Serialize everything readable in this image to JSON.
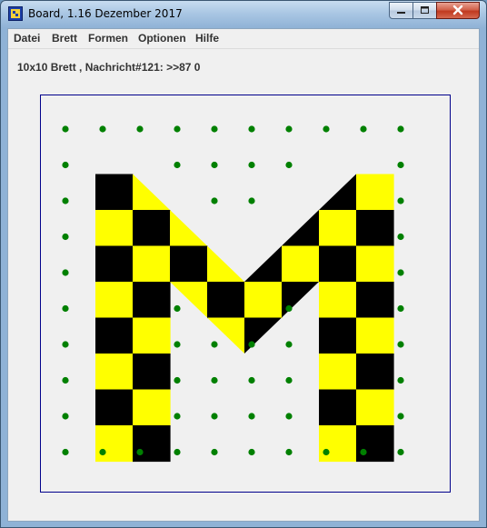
{
  "window": {
    "title": "Board, 1.16 Dezember 2017",
    "icon": "board-app-icon",
    "controls": [
      "minimize-icon",
      "maximize-icon",
      "close-icon"
    ]
  },
  "menu": {
    "items": [
      "Datei",
      "Brett",
      "Formen",
      "Optionen",
      "Hilfe"
    ]
  },
  "status": {
    "text": "10x10 Brett , Nachricht#121: >>87 0"
  },
  "board": {
    "rows": 10,
    "cols": 10,
    "colors": {
      "black": "#000000",
      "yellow": "#ffff00",
      "dot": "#008000",
      "frame": "#00008b",
      "background": "#f0f0f0"
    },
    "cells": [
      {
        "c": 1,
        "r": 1,
        "fill": "black"
      },
      {
        "c": 1,
        "r": 2,
        "fill": "yellow"
      },
      {
        "c": 1,
        "r": 3,
        "fill": "black"
      },
      {
        "c": 1,
        "r": 4,
        "fill": "yellow"
      },
      {
        "c": 1,
        "r": 5,
        "fill": "black"
      },
      {
        "c": 1,
        "r": 6,
        "fill": "yellow"
      },
      {
        "c": 1,
        "r": 7,
        "fill": "black"
      },
      {
        "c": 1,
        "r": 8,
        "fill": "yellow"
      },
      {
        "c": 2,
        "r": 2,
        "fill": "black"
      },
      {
        "c": 2,
        "r": 3,
        "fill": "yellow"
      },
      {
        "c": 2,
        "r": 4,
        "fill": "black"
      },
      {
        "c": 2,
        "r": 5,
        "fill": "yellow"
      },
      {
        "c": 2,
        "r": 6,
        "fill": "black"
      },
      {
        "c": 2,
        "r": 7,
        "fill": "yellow"
      },
      {
        "c": 2,
        "r": 8,
        "fill": "black"
      },
      {
        "c": 3,
        "r": 3,
        "fill": "black"
      },
      {
        "c": 4,
        "r": 4,
        "fill": "black"
      },
      {
        "c": 5,
        "r": 4,
        "fill": "yellow"
      },
      {
        "c": 6,
        "r": 3,
        "fill": "yellow"
      },
      {
        "c": 7,
        "r": 2,
        "fill": "yellow"
      },
      {
        "c": 7,
        "r": 3,
        "fill": "black"
      },
      {
        "c": 7,
        "r": 4,
        "fill": "yellow"
      },
      {
        "c": 7,
        "r": 5,
        "fill": "black"
      },
      {
        "c": 7,
        "r": 6,
        "fill": "yellow"
      },
      {
        "c": 7,
        "r": 7,
        "fill": "black"
      },
      {
        "c": 7,
        "r": 8,
        "fill": "yellow"
      },
      {
        "c": 8,
        "r": 1,
        "fill": "yellow"
      },
      {
        "c": 8,
        "r": 2,
        "fill": "black"
      },
      {
        "c": 8,
        "r": 3,
        "fill": "yellow"
      },
      {
        "c": 8,
        "r": 4,
        "fill": "black"
      },
      {
        "c": 8,
        "r": 5,
        "fill": "yellow"
      },
      {
        "c": 8,
        "r": 6,
        "fill": "black"
      },
      {
        "c": 8,
        "r": 7,
        "fill": "yellow"
      },
      {
        "c": 8,
        "r": 8,
        "fill": "black"
      }
    ],
    "triangles": [
      {
        "c": 2,
        "r": 1,
        "half": "lower-left",
        "fill": "yellow"
      },
      {
        "c": 3,
        "r": 2,
        "half": "lower-left",
        "fill": "yellow"
      },
      {
        "c": 4,
        "r": 3,
        "half": "lower-left",
        "fill": "yellow"
      },
      {
        "c": 5,
        "r": 3,
        "half": "lower-right",
        "fill": "black"
      },
      {
        "c": 6,
        "r": 2,
        "half": "lower-right",
        "fill": "black"
      },
      {
        "c": 7,
        "r": 1,
        "half": "lower-right",
        "fill": "black"
      },
      {
        "c": 3,
        "r": 4,
        "half": "upper-right",
        "fill": "yellow"
      },
      {
        "c": 4,
        "r": 5,
        "half": "upper-right",
        "fill": "yellow"
      },
      {
        "c": 5,
        "r": 5,
        "half": "upper-left",
        "fill": "black"
      },
      {
        "c": 6,
        "r": 4,
        "half": "upper-left",
        "fill": "black"
      }
    ]
  }
}
